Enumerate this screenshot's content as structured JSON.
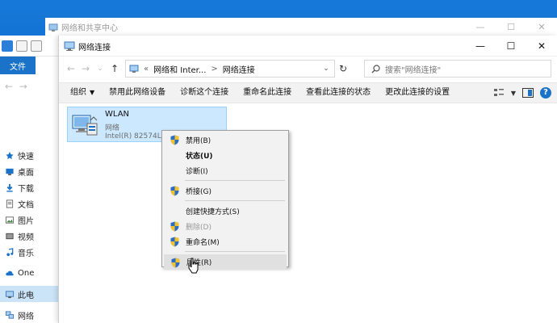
{
  "back_center": {
    "title": "网络和共享中心"
  },
  "back_explorer": {
    "file_tab": "文件",
    "sidebar": [
      {
        "label": "快速",
        "icon": "star-icon"
      },
      {
        "label": "桌面",
        "icon": "desktop-icon"
      },
      {
        "label": "下载",
        "icon": "download-icon"
      },
      {
        "label": "文档",
        "icon": "document-icon"
      },
      {
        "label": "图片",
        "icon": "picture-icon"
      },
      {
        "label": "视频",
        "icon": "video-icon"
      },
      {
        "label": "音乐",
        "icon": "music-icon"
      },
      {
        "label": "One",
        "icon": "cloud-icon"
      },
      {
        "label": "此电",
        "icon": "computer-icon",
        "selected": true
      },
      {
        "label": "网络",
        "icon": "network-icon"
      }
    ]
  },
  "window": {
    "title": "网络连接",
    "controls": {
      "minimize": "—",
      "maximize": "☐",
      "close": "✕"
    }
  },
  "address": {
    "back": "←",
    "forward": "→",
    "recent": "⌄",
    "up": "↑",
    "prefix": "«",
    "crumbs": [
      "网络和 Inter...",
      "网络连接"
    ],
    "separator": ">",
    "dropdown": "⌄",
    "refresh": "↻",
    "search_placeholder": "搜索\"网络连接\""
  },
  "commandbar": {
    "organize": "组织",
    "items": [
      "禁用此网络设备",
      "诊断这个连接",
      "重命名此连接",
      "查看此连接的状态",
      "更改此连接的设置"
    ],
    "help": "?"
  },
  "adapter": {
    "name": "WLAN",
    "status": "网络",
    "device": "Intel(R) 82574L"
  },
  "context_menu": {
    "items": [
      {
        "label": "禁用(B)",
        "shield": true
      },
      {
        "label": "状态(U)",
        "bold": true
      },
      {
        "label": "诊断(I)"
      },
      {
        "separator": true
      },
      {
        "label": "桥接(G)",
        "shield": true
      },
      {
        "separator": true
      },
      {
        "label": "创建快捷方式(S)"
      },
      {
        "label": "删除(D)",
        "shield": true,
        "disabled": true
      },
      {
        "label": "重命名(M)",
        "shield": true
      },
      {
        "separator": true
      },
      {
        "label": "属性(R)",
        "shield": true,
        "hover": true
      }
    ]
  },
  "colors": {
    "desktop": "#0b5cc4",
    "selection": "#cce8ff",
    "accent": "#1a73c9"
  }
}
